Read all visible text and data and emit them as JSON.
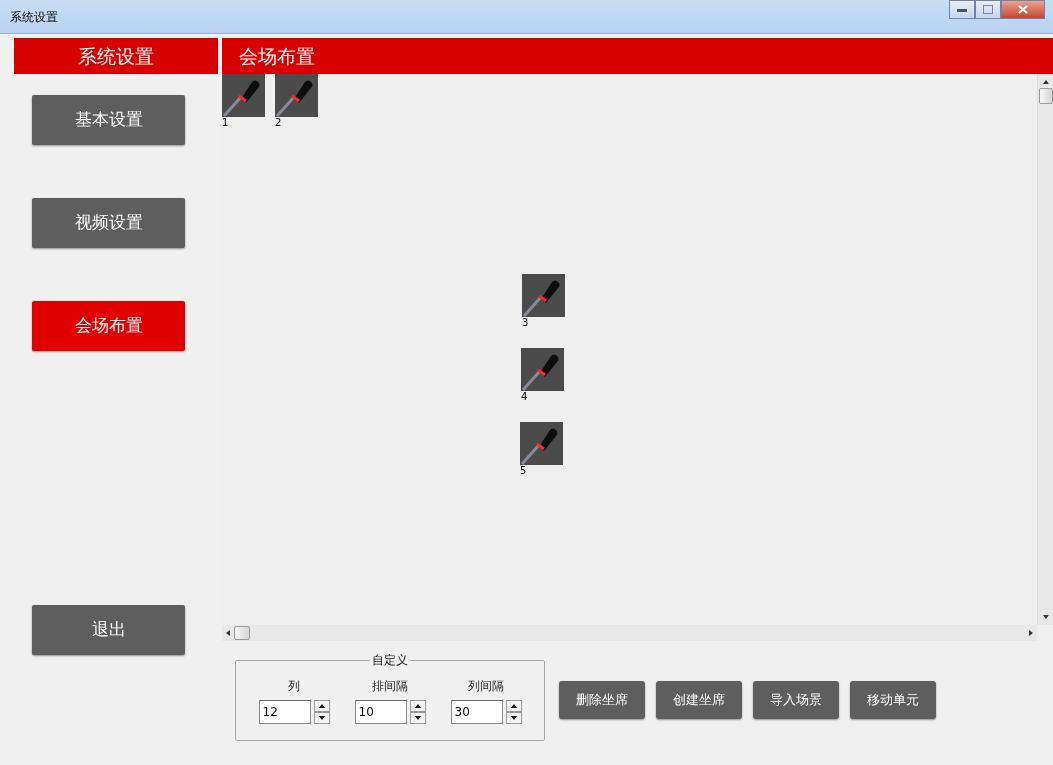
{
  "window": {
    "title": "系统设置"
  },
  "sidebar": {
    "title": "系统设置",
    "items": [
      {
        "label": "基本设置",
        "selected": false
      },
      {
        "label": "视频设置",
        "selected": false
      },
      {
        "label": "会场布置",
        "selected": true
      },
      {
        "label": "退出",
        "selected": false
      }
    ]
  },
  "panel": {
    "title": "会场布置",
    "seats": [
      {
        "number": "1"
      },
      {
        "number": "2"
      },
      {
        "number": "3"
      },
      {
        "number": "4"
      },
      {
        "number": "5"
      }
    ]
  },
  "custom_group": {
    "title": "自定义",
    "fields": [
      {
        "label": "列",
        "value": "12"
      },
      {
        "label": "排间隔",
        "value": "10"
      },
      {
        "label": "列间隔",
        "value": "30"
      }
    ]
  },
  "buttons": [
    "删除坐席",
    "创建坐席",
    "导入场景",
    "移动单元"
  ]
}
